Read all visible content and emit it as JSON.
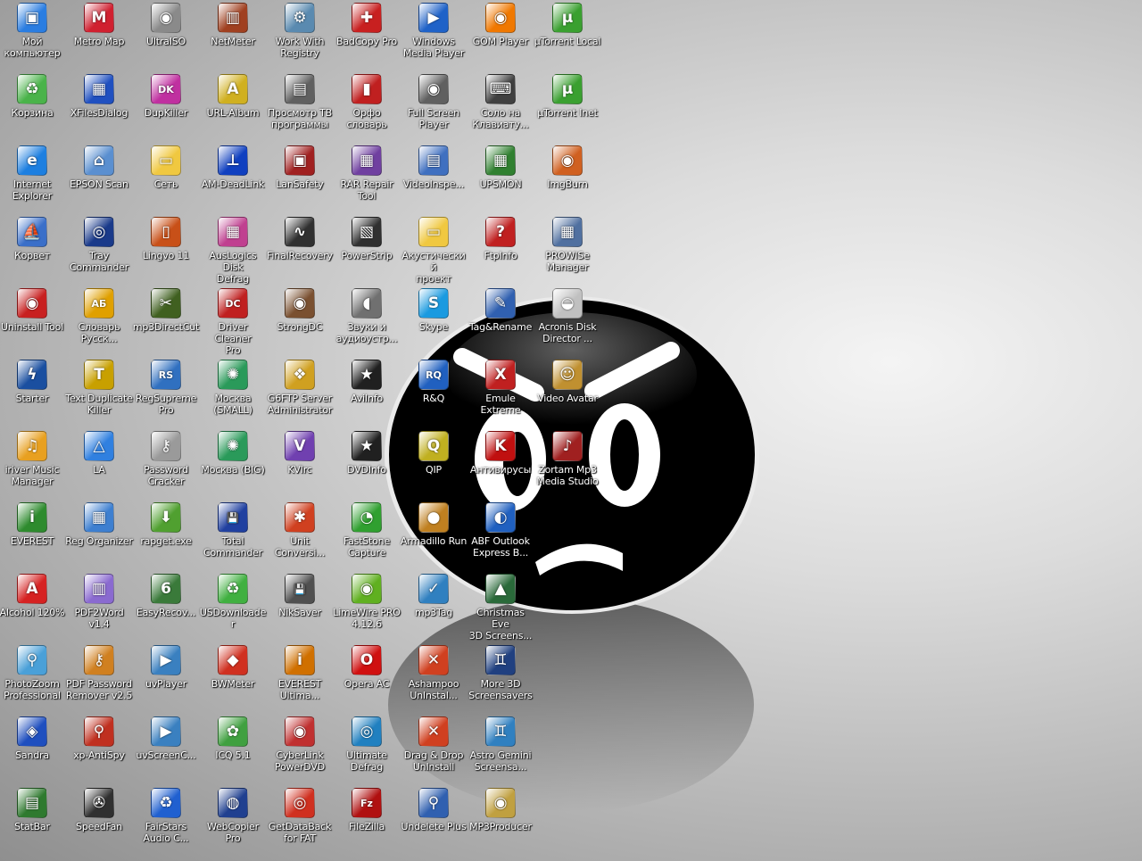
{
  "desktop": {
    "columns": [
      {
        "name": "col-1",
        "items": [
          {
            "label": "Мой\nкомпьютер",
            "icon": "my-computer-icon",
            "color": "#2a7de1",
            "glyph": "▣"
          },
          {
            "label": "Корзина",
            "icon": "recycle-bin-icon",
            "color": "#4ab34a",
            "glyph": "♻"
          },
          {
            "label": "Internet\nExplorer",
            "icon": "internet-explorer-icon",
            "color": "#1d7fe0",
            "glyph": "e"
          },
          {
            "label": "Корвет",
            "icon": "korvet-icon",
            "color": "#3a6fc9",
            "glyph": "⛵"
          },
          {
            "label": "Uninstall Tool",
            "icon": "uninstall-tool-icon",
            "color": "#c82020",
            "glyph": "◉"
          },
          {
            "label": "Starter",
            "icon": "starter-icon",
            "color": "#1a4fa0",
            "glyph": "ϟ"
          },
          {
            "label": "iriver Music\nManager",
            "icon": "iriver-music-manager-icon",
            "color": "#e8a020",
            "glyph": "♫"
          },
          {
            "label": "EVEREST",
            "icon": "everest-icon",
            "color": "#2e8b2e",
            "glyph": "i"
          },
          {
            "label": "Alcohol 120%",
            "icon": "alcohol-120-icon",
            "color": "#d62222",
            "glyph": "A"
          },
          {
            "label": "PhotoZoom\nProfessional",
            "icon": "photozoom-icon",
            "color": "#4aa0d8",
            "glyph": "⚲"
          },
          {
            "label": "Sandra",
            "icon": "sandra-icon",
            "color": "#1f4fbf",
            "glyph": "◈"
          },
          {
            "label": "StatBar",
            "icon": "statbar-icon",
            "color": "#2f7a2f",
            "glyph": "▤"
          }
        ]
      },
      {
        "name": "col-2",
        "items": [
          {
            "label": "Metro Map",
            "icon": "metro-map-icon",
            "color": "#d02030",
            "glyph": "M"
          },
          {
            "label": "XFilesDialog",
            "icon": "xfilesdialog-icon",
            "color": "#2050c0",
            "glyph": "▦"
          },
          {
            "label": "EPSON Scan",
            "icon": "epson-scan-icon",
            "color": "#5a8fd0",
            "glyph": "⌂"
          },
          {
            "label": "Tray\nCommander",
            "icon": "tray-commander-icon",
            "color": "#1a3a8a",
            "glyph": "◎"
          },
          {
            "label": "Словарь\nРусск...",
            "icon": "dictionary-icon",
            "color": "#e0a000",
            "glyph": "АБ"
          },
          {
            "label": "Text Duplicate\nKiller",
            "icon": "text-duplicate-killer-icon",
            "color": "#c8a000",
            "glyph": "T"
          },
          {
            "label": "LA",
            "icon": "la-icon",
            "color": "#3080e0",
            "glyph": "△"
          },
          {
            "label": "Reg Organizer",
            "icon": "reg-organizer-icon",
            "color": "#3d7fd0",
            "glyph": "▦"
          },
          {
            "label": "PDF2Word\nv1.4",
            "icon": "pdf2word-icon",
            "color": "#8a6ad0",
            "glyph": "▥"
          },
          {
            "label": "PDF Password\nRemover v2.5",
            "icon": "pdf-password-remover-icon",
            "color": "#d08020",
            "glyph": "⚷"
          },
          {
            "label": "xp-AntiSpy",
            "icon": "xp-antispy-icon",
            "color": "#c03020",
            "glyph": "⚲"
          },
          {
            "label": "SpeedFan",
            "icon": "speedfan-icon",
            "color": "#303030",
            "glyph": "✇"
          }
        ]
      },
      {
        "name": "col-3",
        "items": [
          {
            "label": "UltraISO",
            "icon": "ultraiso-icon",
            "color": "#8a8a8a",
            "glyph": "◉"
          },
          {
            "label": "DupKiller",
            "icon": "dupkiller-icon",
            "color": "#c030a0",
            "glyph": "DK"
          },
          {
            "label": "Сеть",
            "icon": "network-folder-icon",
            "color": "#f0c840",
            "glyph": "▭"
          },
          {
            "label": "Lingvo 11",
            "icon": "lingvo-icon",
            "color": "#c85018",
            "glyph": "▯"
          },
          {
            "label": "mp3DirectCut",
            "icon": "mp3directcut-icon",
            "color": "#406020",
            "glyph": "✂"
          },
          {
            "label": "RegSupreme\nPro",
            "icon": "regsupreme-icon",
            "color": "#3070c0",
            "glyph": "RS"
          },
          {
            "label": "Password\nCracker",
            "icon": "password-cracker-icon",
            "color": "#9a9a9a",
            "glyph": "⚷"
          },
          {
            "label": "rapget.exe",
            "icon": "rapget-icon",
            "color": "#50a030",
            "glyph": "⬇"
          },
          {
            "label": "EasyRecov...",
            "icon": "easyrecovery-icon",
            "color": "#3a7a3a",
            "glyph": "6"
          },
          {
            "label": "uvPlayer",
            "icon": "uvplayer-icon",
            "color": "#3a80c0",
            "glyph": "▶"
          },
          {
            "label": "uvScreenC...",
            "icon": "uvscreencamera-icon",
            "color": "#3a80c0",
            "glyph": "▶"
          },
          {
            "label": "FairStars\nAudio C...",
            "icon": "fairstars-audio-converter-icon",
            "color": "#2060d0",
            "glyph": "♻"
          }
        ]
      },
      {
        "name": "col-4",
        "items": [
          {
            "label": "NetMeter",
            "icon": "netmeter-icon",
            "color": "#a04020",
            "glyph": "▥"
          },
          {
            "label": "URL-Album",
            "icon": "url-album-icon",
            "color": "#d0b020",
            "glyph": "A"
          },
          {
            "label": "AM-DeadLink",
            "icon": "am-deadlink-icon",
            "color": "#1040c0",
            "glyph": "⊥"
          },
          {
            "label": "AusLogics Disk\nDefrag",
            "icon": "auslogics-disk-defrag-icon",
            "color": "#c04090",
            "glyph": "▦"
          },
          {
            "label": "Driver Cleaner\nPro",
            "icon": "driver-cleaner-icon",
            "color": "#c02020",
            "glyph": "DC"
          },
          {
            "label": "Москва\n(SMALL)",
            "icon": "moscow-small-icon",
            "color": "#2a9a5a",
            "glyph": "✺"
          },
          {
            "label": "Москва (BIG)",
            "icon": "moscow-big-icon",
            "color": "#2a9a5a",
            "glyph": "✺"
          },
          {
            "label": "Total\nCommander",
            "icon": "total-commander-icon",
            "color": "#2040a0",
            "glyph": "💾"
          },
          {
            "label": "USDownloader",
            "icon": "usdownloader-icon",
            "color": "#40b040",
            "glyph": "♻"
          },
          {
            "label": "BWMeter",
            "icon": "bwmeter-icon",
            "color": "#d03020",
            "glyph": "◆"
          },
          {
            "label": "ICQ 5.1",
            "icon": "icq-icon",
            "color": "#40a040",
            "glyph": "✿"
          },
          {
            "label": "WebCopier\nPro",
            "icon": "webcopier-icon",
            "color": "#204090",
            "glyph": "◍"
          }
        ]
      },
      {
        "name": "col-5",
        "items": [
          {
            "label": "Work With\nRegistry",
            "icon": "work-with-registry-icon",
            "color": "#5a8ab0",
            "glyph": "⚙"
          },
          {
            "label": "Просмотр ТВ\nпрограммы",
            "icon": "tv-program-viewer-icon",
            "color": "#606060",
            "glyph": "▤"
          },
          {
            "label": "LanSafety",
            "icon": "lansafety-icon",
            "color": "#a02020",
            "glyph": "▣"
          },
          {
            "label": "FinalRecovery",
            "icon": "finalrecovery-icon",
            "color": "#303030",
            "glyph": "∿"
          },
          {
            "label": "StrongDC",
            "icon": "strongdc-icon",
            "color": "#7a5030",
            "glyph": "◉"
          },
          {
            "label": "G6FTP Server\nAdministrator",
            "icon": "g6ftp-icon",
            "color": "#d0a020",
            "glyph": "❖"
          },
          {
            "label": "KVIrc",
            "icon": "kvirc-icon",
            "color": "#7040b0",
            "glyph": "V"
          },
          {
            "label": "Unit\nConversi...",
            "icon": "unit-conversion-icon",
            "color": "#d04020",
            "glyph": "✱"
          },
          {
            "label": "NikSaver",
            "icon": "niksaver-icon",
            "color": "#505050",
            "glyph": "💾"
          },
          {
            "label": "EVEREST\nUltima...",
            "icon": "everest-ultimate-icon",
            "color": "#d07000",
            "glyph": "i"
          },
          {
            "label": "CyberLink\nPowerDVD",
            "icon": "powerdvd-icon",
            "color": "#c03030",
            "glyph": "◉"
          },
          {
            "label": "GetDataBack\nfor FAT",
            "icon": "getdataback-icon",
            "color": "#d03020",
            "glyph": "◎"
          }
        ]
      },
      {
        "name": "col-6",
        "items": [
          {
            "label": "BadCopy Pro",
            "icon": "badcopy-pro-icon",
            "color": "#c82020",
            "glyph": "✚"
          },
          {
            "label": "Орфо\nсловарь",
            "icon": "orfo-dictionary-icon",
            "color": "#c02020",
            "glyph": "▮"
          },
          {
            "label": "RAR Repair\nTool",
            "icon": "rar-repair-icon",
            "color": "#7040a0",
            "glyph": "▦"
          },
          {
            "label": "PowerStrip",
            "icon": "powerstrip-icon",
            "color": "#303030",
            "glyph": "▧"
          },
          {
            "label": "Звуки и\nаудиоустр...",
            "icon": "sounds-audio-devices-icon",
            "color": "#707070",
            "glyph": "◖"
          },
          {
            "label": "AviInfo",
            "icon": "aviinfo-icon",
            "color": "#202020",
            "glyph": "★"
          },
          {
            "label": "DVDInfo",
            "icon": "dvdinfo-icon",
            "color": "#202020",
            "glyph": "★"
          },
          {
            "label": "FastStone\nCapture",
            "icon": "faststone-capture-icon",
            "color": "#30a030",
            "glyph": "◔"
          },
          {
            "label": "LimeWire PRO\n4.12.6",
            "icon": "limewire-icon",
            "color": "#60b020",
            "glyph": "◉"
          },
          {
            "label": "Opera AC",
            "icon": "opera-ac-icon",
            "color": "#d01010",
            "glyph": "O"
          },
          {
            "label": "Ultimate\nDefrag",
            "icon": "ultimate-defrag-icon",
            "color": "#2080c0",
            "glyph": "◎"
          },
          {
            "label": "FileZilla",
            "icon": "filezilla-icon",
            "color": "#b01010",
            "glyph": "Fz"
          }
        ]
      },
      {
        "name": "col-7",
        "items": [
          {
            "label": "Windows\nMedia Player",
            "icon": "windows-media-player-icon",
            "color": "#1f62c8",
            "glyph": "▶"
          },
          {
            "label": "Full Screen\nPlayer",
            "icon": "full-screen-player-icon",
            "color": "#606060",
            "glyph": "◉"
          },
          {
            "label": "VideoInspe...",
            "icon": "videoinspector-icon",
            "color": "#4070c0",
            "glyph": "▤"
          },
          {
            "label": "Акустический\nпроект",
            "icon": "acoustic-project-folder-icon",
            "color": "#f0c840",
            "glyph": "▭"
          },
          {
            "label": "Skype",
            "icon": "skype-icon",
            "color": "#1a9ae0",
            "glyph": "S"
          },
          {
            "label": "R&Q",
            "icon": "rnq-icon",
            "color": "#2060c0",
            "glyph": "RQ"
          },
          {
            "label": "QIP",
            "icon": "qip-icon",
            "color": "#c0b020",
            "glyph": "Q"
          },
          {
            "label": "Armadillo Run",
            "icon": "armadillo-run-icon",
            "color": "#c08020",
            "glyph": "●"
          },
          {
            "label": "mp3Tag",
            "icon": "mp3tag-icon",
            "color": "#3080c0",
            "glyph": "✓"
          },
          {
            "label": "Ashampoo\nUnInstal...",
            "icon": "ashampoo-uninstaller-icon",
            "color": "#d04020",
            "glyph": "✕"
          },
          {
            "label": "Drag & Drop\nUnInstall",
            "icon": "drag-drop-uninstall-icon",
            "color": "#d04020",
            "glyph": "✕"
          },
          {
            "label": "Undelete Plus",
            "icon": "undelete-plus-icon",
            "color": "#3060b0",
            "glyph": "⚲"
          }
        ]
      },
      {
        "name": "col-8",
        "items": [
          {
            "label": "GOM Player",
            "icon": "gom-player-icon",
            "color": "#f07800",
            "glyph": "◉"
          },
          {
            "label": "Соло на\nКлавиату...",
            "icon": "solo-keyboard-icon",
            "color": "#404040",
            "glyph": "⌨"
          },
          {
            "label": "UPSMON",
            "icon": "upsmon-icon",
            "color": "#308030",
            "glyph": "▦"
          },
          {
            "label": "FtpInfo",
            "icon": "ftpinfo-icon",
            "color": "#c02020",
            "glyph": "?"
          },
          {
            "label": "Tag&Rename",
            "icon": "tag-rename-icon",
            "color": "#3060b0",
            "glyph": "✎"
          },
          {
            "label": "Emule Extreme",
            "icon": "emule-extreme-icon",
            "color": "#c02020",
            "glyph": "X"
          },
          {
            "label": "Антивирусы",
            "icon": "antivirus-icon",
            "color": "#c01010",
            "glyph": "K"
          },
          {
            "label": "ABF Outlook\nExpress B...",
            "icon": "abf-outlook-backup-icon",
            "color": "#2060c0",
            "glyph": "◐"
          },
          {
            "label": "Christmas Eve\n3D Screens...",
            "icon": "christmas-eve-screensaver-icon",
            "color": "#2a6a3a",
            "glyph": "▲"
          },
          {
            "label": "More 3D\nScreensavers",
            "icon": "more-3d-screensavers-icon",
            "color": "#204080",
            "glyph": "♊"
          },
          {
            "label": "Astro Gemini\nScreensa...",
            "icon": "astro-gemini-screensaver-icon",
            "color": "#3080c0",
            "glyph": "♊"
          },
          {
            "label": "MP3Producer",
            "icon": "mp3producer-icon",
            "color": "#c0a040",
            "glyph": "◉"
          }
        ]
      },
      {
        "name": "col-9",
        "items": [
          {
            "label": "µTorrent Local",
            "icon": "utorrent-local-icon",
            "color": "#3aa030",
            "glyph": "µ"
          },
          {
            "label": "µTorrent Inet",
            "icon": "utorrent-inet-icon",
            "color": "#3aa030",
            "glyph": "µ"
          },
          {
            "label": "ImgBurn",
            "icon": "imgburn-icon",
            "color": "#d06020",
            "glyph": "◉"
          },
          {
            "label": "PROWISe\nManager",
            "icon": "prowise-manager-icon",
            "color": "#5070a0",
            "glyph": "▦"
          },
          {
            "label": "Acronis Disk\nDirector ...",
            "icon": "acronis-disk-director-icon",
            "color": "#c0c0c0",
            "glyph": "◒"
          },
          {
            "label": "Video Avatar",
            "icon": "video-avatar-icon",
            "color": "#c09030",
            "glyph": "☺"
          },
          {
            "label": "Zortam Mp3\nMedia Studio",
            "icon": "zortam-mp3-icon",
            "color": "#a02020",
            "glyph": "♪"
          }
        ]
      }
    ]
  }
}
